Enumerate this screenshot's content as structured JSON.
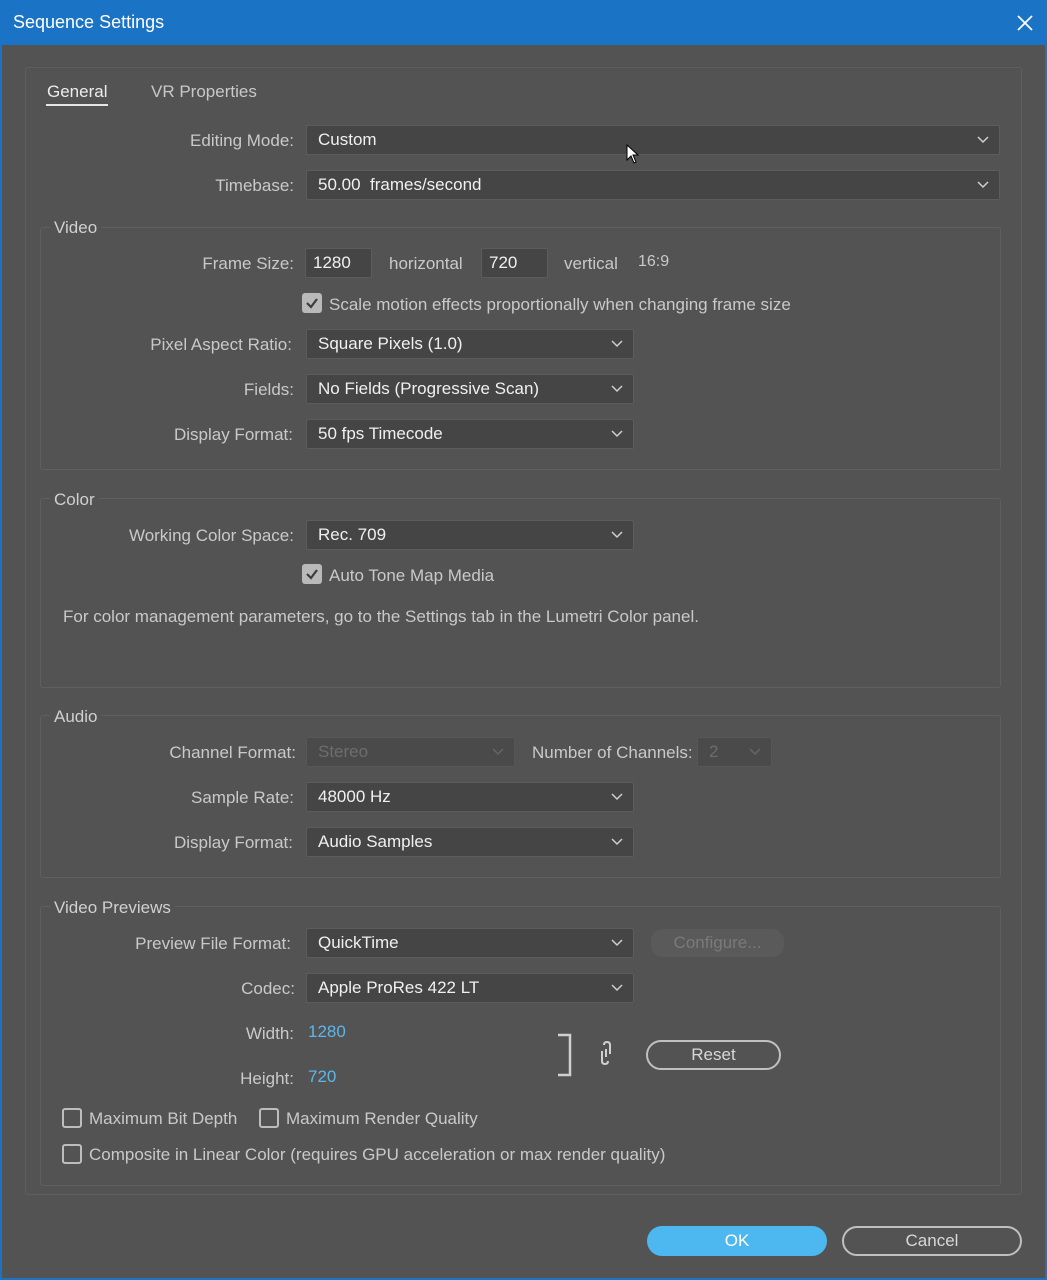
{
  "window": {
    "title": "Sequence Settings"
  },
  "tabs": [
    {
      "label": "General",
      "active": true
    },
    {
      "label": "VR Properties",
      "active": false
    }
  ],
  "general": {
    "editing_mode_label": "Editing Mode:",
    "editing_mode_value": "Custom",
    "timebase_label": "Timebase:",
    "timebase_value": "50.00  frames/second"
  },
  "video": {
    "title": "Video",
    "frame_size_label": "Frame Size:",
    "width_value": "1280",
    "horizontal_label": "horizontal",
    "height_value": "720",
    "vertical_label": "vertical",
    "aspect_text": "16:9",
    "scale_motion_label": "Scale motion effects proportionally when changing frame size",
    "scale_motion_checked": true,
    "par_label": "Pixel Aspect Ratio:",
    "par_value": "Square Pixels (1.0)",
    "fields_label": "Fields:",
    "fields_value": "No Fields (Progressive Scan)",
    "display_format_label": "Display Format:",
    "display_format_value": "50 fps Timecode"
  },
  "color": {
    "title": "Color",
    "working_space_label": "Working Color Space:",
    "working_space_value": "Rec. 709",
    "auto_tone_label": "Auto Tone Map Media",
    "auto_tone_checked": true,
    "info_text": "For color management parameters, go to the Settings tab in the Lumetri Color panel."
  },
  "audio": {
    "title": "Audio",
    "channel_format_label": "Channel Format:",
    "channel_format_value": "Stereo",
    "num_channels_label": "Number of Channels:",
    "num_channels_value": "2",
    "sample_rate_label": "Sample Rate:",
    "sample_rate_value": "48000 Hz",
    "display_format_label": "Display Format:",
    "display_format_value": "Audio Samples"
  },
  "previews": {
    "title": "Video Previews",
    "file_format_label": "Preview File Format:",
    "file_format_value": "QuickTime",
    "configure_label": "Configure...",
    "codec_label": "Codec:",
    "codec_value": "Apple ProRes 422 LT",
    "width_label": "Width:",
    "width_value": "1280",
    "height_label": "Height:",
    "height_value": "720",
    "reset_label": "Reset",
    "max_bit_depth_label": "Maximum Bit Depth",
    "max_bit_depth_checked": false,
    "max_render_quality_label": "Maximum Render Quality",
    "max_render_quality_checked": false,
    "composite_linear_label": "Composite in Linear Color (requires GPU acceleration or max render quality)",
    "composite_linear_checked": false
  },
  "footer": {
    "ok_label": "OK",
    "cancel_label": "Cancel"
  },
  "colors": {
    "titlebar": "#1a73c4",
    "background": "#535353",
    "accent": "#4db8f0",
    "link": "#5cb6ec"
  }
}
